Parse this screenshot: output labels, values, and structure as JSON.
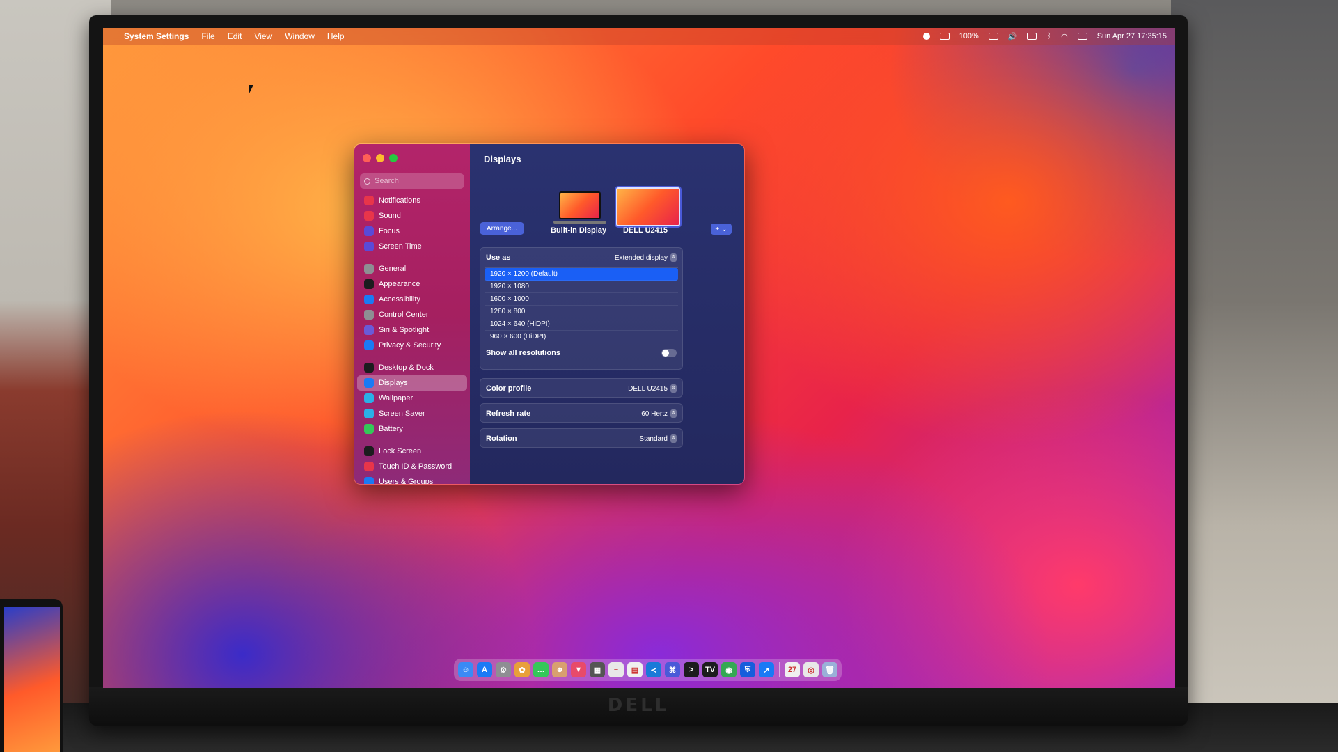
{
  "menubar": {
    "app_name": "System Settings",
    "menus": [
      "File",
      "Edit",
      "View",
      "Window",
      "Help"
    ],
    "battery": "100%",
    "clock": "Sun Apr 27  17:35:15"
  },
  "sidebar": {
    "search_placeholder": "Search",
    "groups": [
      [
        {
          "label": "Notifications",
          "icon": "bell-icon",
          "color": "#e8354a"
        },
        {
          "label": "Sound",
          "icon": "speaker-icon",
          "color": "#e8354a"
        },
        {
          "label": "Focus",
          "icon": "moon-icon",
          "color": "#5a4ad8"
        },
        {
          "label": "Screen Time",
          "icon": "hourglass-icon",
          "color": "#5a4ad8"
        }
      ],
      [
        {
          "label": "General",
          "icon": "gear-icon",
          "color": "#8e8e93"
        },
        {
          "label": "Appearance",
          "icon": "circle-half-icon",
          "color": "#1c1c1e"
        },
        {
          "label": "Accessibility",
          "icon": "accessibility-icon",
          "color": "#1a7af5"
        },
        {
          "label": "Control Center",
          "icon": "toggles-icon",
          "color": "#8e8e93"
        },
        {
          "label": "Siri & Spotlight",
          "icon": "siri-icon",
          "color": "#6a5ad8"
        },
        {
          "label": "Privacy & Security",
          "icon": "hand-icon",
          "color": "#1a7af5"
        }
      ],
      [
        {
          "label": "Desktop & Dock",
          "icon": "dock-icon",
          "color": "#1c1c1e"
        },
        {
          "label": "Displays",
          "icon": "sun-icon",
          "color": "#1a7af5",
          "selected": true
        },
        {
          "label": "Wallpaper",
          "icon": "wallpaper-icon",
          "color": "#2ab0e8"
        },
        {
          "label": "Screen Saver",
          "icon": "screensaver-icon",
          "color": "#2ab0e8"
        },
        {
          "label": "Battery",
          "icon": "battery-icon",
          "color": "#34c759"
        }
      ],
      [
        {
          "label": "Lock Screen",
          "icon": "lock-icon",
          "color": "#1c1c1e"
        },
        {
          "label": "Touch ID & Password",
          "icon": "fingerprint-icon",
          "color": "#e8354a"
        },
        {
          "label": "Users & Groups",
          "icon": "users-icon",
          "color": "#1a7af5"
        }
      ]
    ]
  },
  "main": {
    "title": "Displays",
    "arrange_label": "Arrange...",
    "add_label": "+",
    "displays": [
      {
        "label": "Built-in Display"
      },
      {
        "label": "DELL U2415",
        "selected": true
      }
    ],
    "use_as_label": "Use as",
    "use_as_value": "Extended display",
    "resolutions": [
      {
        "label": "1920 × 1200 (Default)",
        "selected": true
      },
      {
        "label": "1920 × 1080"
      },
      {
        "label": "1600 × 1000"
      },
      {
        "label": "1280 × 800"
      },
      {
        "label": "1024 × 640 (HiDPI)"
      },
      {
        "label": "960 × 600 (HiDPI)"
      }
    ],
    "show_all_label": "Show all resolutions",
    "show_all_enabled": false,
    "color_profile_label": "Color profile",
    "color_profile_value": "DELL U2415",
    "refresh_rate_label": "Refresh rate",
    "refresh_rate_value": "60 Hertz",
    "rotation_label": "Rotation",
    "rotation_value": "Standard"
  },
  "dock": {
    "apps": [
      {
        "name": "finder-icon",
        "color": "#3a8af5",
        "glyph": "☺"
      },
      {
        "name": "app-store-icon",
        "color": "#1a7af5",
        "glyph": "A"
      },
      {
        "name": "system-settings-icon",
        "color": "#8e8e93",
        "glyph": "⚙"
      },
      {
        "name": "photos-icon",
        "color": "#e8a03a",
        "glyph": "✿"
      },
      {
        "name": "messages-icon",
        "color": "#34c759",
        "glyph": "…"
      },
      {
        "name": "contacts-icon",
        "color": "#d8a070",
        "glyph": "☻"
      },
      {
        "name": "shield-app-icon",
        "color": "#e84a6a",
        "glyph": "▼"
      },
      {
        "name": "calculator-icon",
        "color": "#555",
        "glyph": "▦"
      },
      {
        "name": "notes-icon",
        "color": "#e8e8e8",
        "glyph": "≡"
      },
      {
        "name": "document-icon",
        "color": "#f0f0f0",
        "glyph": "▤"
      },
      {
        "name": "vscode-icon",
        "color": "#1a7ad8",
        "glyph": "≺"
      },
      {
        "name": "network-icon",
        "color": "#4a5ad8",
        "glyph": "⌘"
      },
      {
        "name": "terminal-icon",
        "color": "#1c1c1e",
        "glyph": ">"
      },
      {
        "name": "tradingview-icon",
        "color": "#1c1c1e",
        "glyph": "TV"
      },
      {
        "name": "chrome-icon",
        "color": "#34a853",
        "glyph": "◉"
      },
      {
        "name": "bitwarden-icon",
        "color": "#175ddc",
        "glyph": "⛨"
      },
      {
        "name": "arrow-app-icon",
        "color": "#1a7af5",
        "glyph": "↗"
      }
    ],
    "others": [
      {
        "name": "calendar-icon",
        "color": "#f0f0f0",
        "glyph": "27"
      },
      {
        "name": "preview-icon",
        "color": "#e8e8e8",
        "glyph": "◎"
      },
      {
        "name": "trash-icon",
        "color": "#9ab0d8",
        "glyph": "🗑"
      }
    ]
  }
}
